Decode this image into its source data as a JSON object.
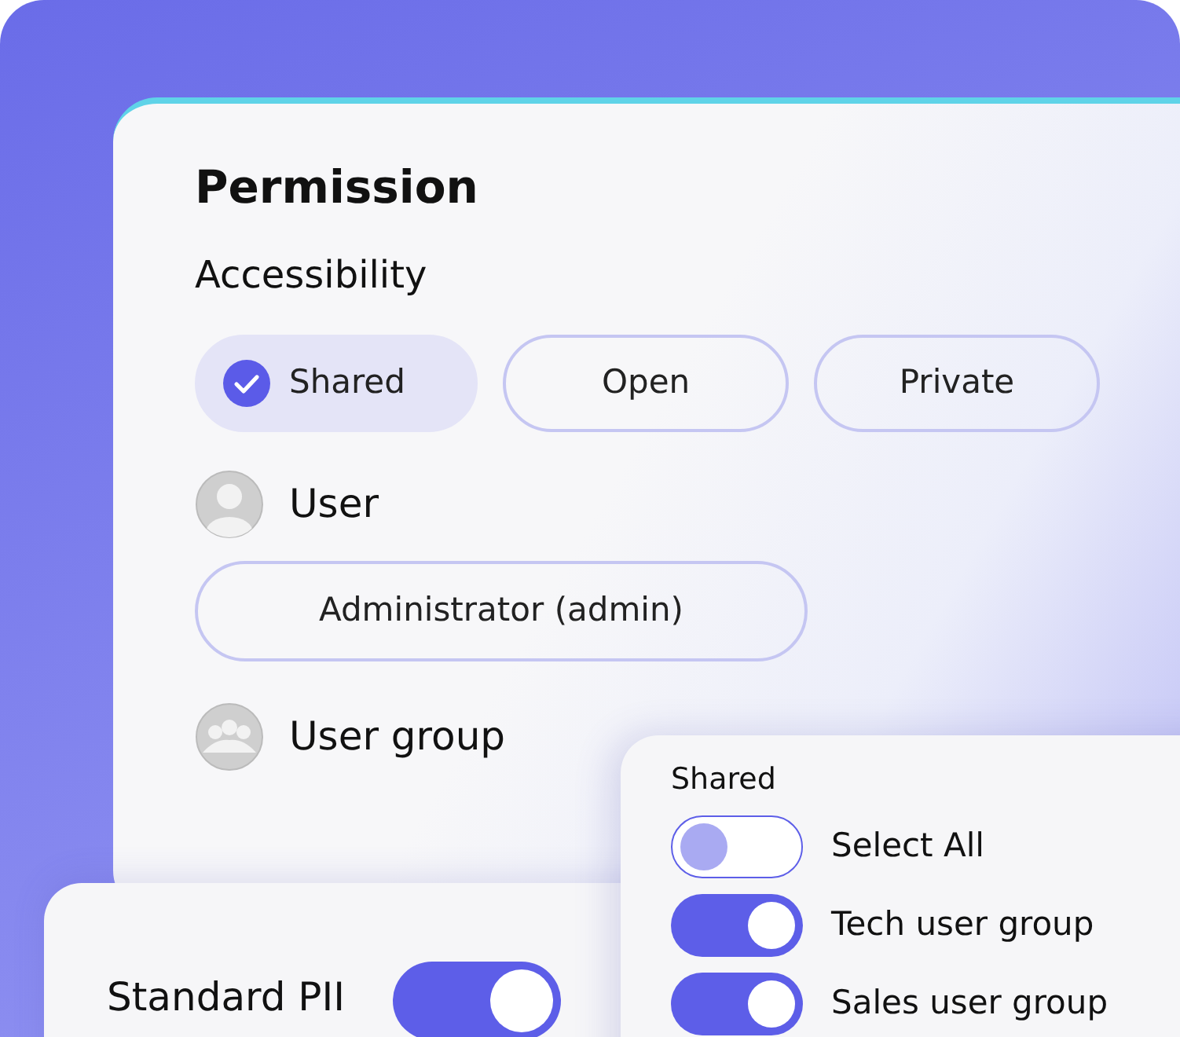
{
  "title": "Permission",
  "section": "Accessibility",
  "options": [
    {
      "label": "Shared",
      "selected": true
    },
    {
      "label": "Open",
      "selected": false
    },
    {
      "label": "Private",
      "selected": false
    }
  ],
  "user": {
    "label": "User",
    "value": "Administrator (admin)"
  },
  "user_group": {
    "label": "User group"
  },
  "pii": {
    "label": "Standard PII",
    "on": true
  },
  "shared_panel": {
    "title": "Shared",
    "items": [
      {
        "label": "Select All",
        "on": false
      },
      {
        "label": "Tech user group",
        "on": true
      },
      {
        "label": "Sales user group",
        "on": true
      }
    ]
  }
}
